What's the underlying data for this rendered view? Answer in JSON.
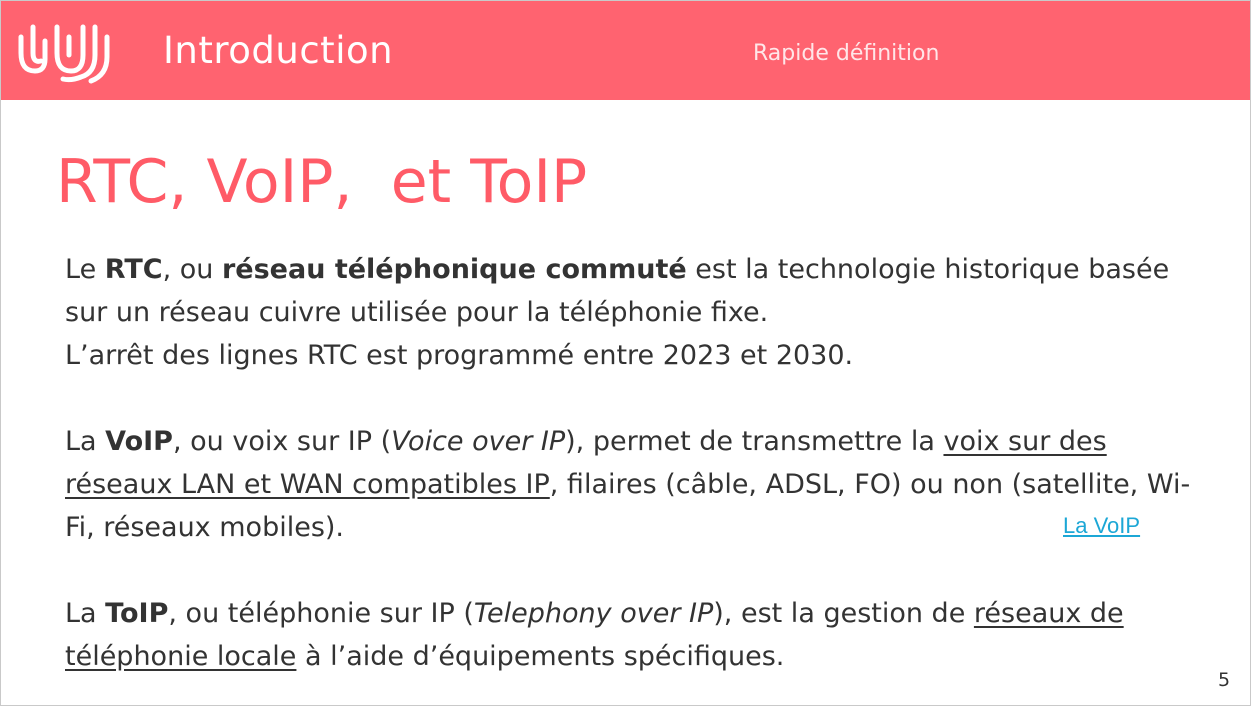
{
  "header": {
    "title": "Introduction",
    "subtitle": "Rapide définition",
    "logo_icon": "wave-logo-icon",
    "background_color": "#ff6370"
  },
  "slide": {
    "title": "RTC, VoIP,  et ToIP",
    "title_color": "#ff5b67",
    "page_number": "5"
  },
  "paragraphs": {
    "rtc": {
      "t1": "Le ",
      "b1": "RTC",
      "t2": ", ou ",
      "b2": "réseau téléphonique commuté",
      "t3": " est la technologie historique basée sur un réseau cuivre utilisée pour la téléphonie fixe.",
      "t4": "L’arrêt des lignes RTC est programmé entre 2023 et 2030."
    },
    "voip": {
      "t1": "La ",
      "b1": "VoIP",
      "t2": ", ou voix sur IP (",
      "i1": "Voice over IP",
      "t3": "), permet de transmettre la ",
      "u1": "voix sur des réseaux LAN et WAN compatibles IP",
      "t4": ", filaires (câble, ADSL, FO) ou non (satellite, Wi-Fi, réseaux mobiles)."
    },
    "toip": {
      "t1": "La ",
      "b1": "ToIP",
      "t2": ", ou téléphonie sur IP (",
      "i1": "Telephony over IP",
      "t3": "), est la gestion de ",
      "u1": "réseaux de téléphonie locale",
      "t4": " à l’aide d’équipements spécifiques."
    }
  },
  "links": {
    "voip_link": "La VoIP",
    "link_color": "#1ca7d6"
  }
}
